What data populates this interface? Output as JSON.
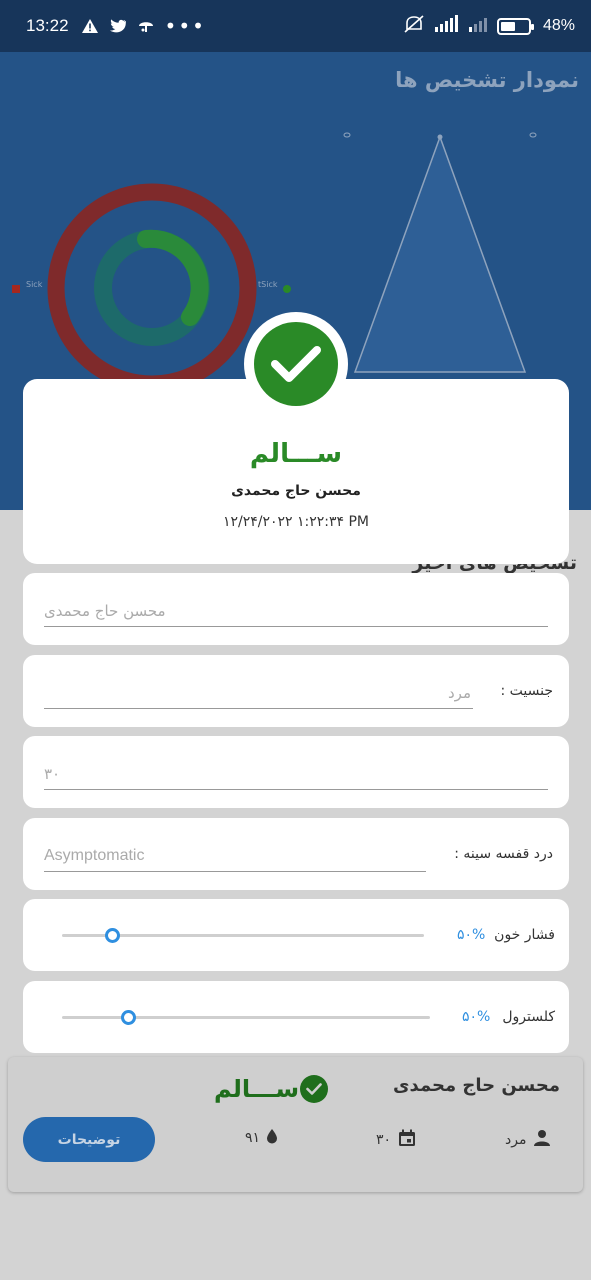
{
  "status_bar": {
    "time": "13:22",
    "battery": "48%",
    "battery_level": 0.48
  },
  "background": {
    "chart_title": "نمودار تشخیص ها",
    "legend_sick": "Sick",
    "legend_notsick": "tSick",
    "section_title": "تشخیص های اخیر"
  },
  "dialog": {
    "status": "ســـالم",
    "name": "محسن حاج محمدی",
    "datetime": "۱۲/۲۴/۲۰۲۲ ۱:۲۲:۳۴ PM"
  },
  "form": {
    "name_value": "محسن حاج محمدی",
    "gender_label": "جنسیت :",
    "gender_value": "مرد",
    "age_value": "۳۰",
    "chest_pain_label": "درد قفسه سینه :",
    "chest_pain_value": "Asymptomatic",
    "blood_pressure_label": "فشار خون",
    "blood_pressure_pct": "۵۰%",
    "blood_pressure_level": 0.14,
    "cholesterol_label": "کلسترول",
    "cholesterol_pct": "۵۰%",
    "cholesterol_level": 0.18
  },
  "recent_card": {
    "name": "محسن حاج محمدی",
    "status": "ســـالم",
    "gender": "مرد",
    "age": "۳۰",
    "value": "۹۱",
    "description_button": "توضیحات"
  },
  "colors": {
    "primary_blue": "#2568ad",
    "healthy_green": "#2a8a27",
    "sick_red": "#a5281f",
    "accent_blue": "#2f8fe0"
  }
}
